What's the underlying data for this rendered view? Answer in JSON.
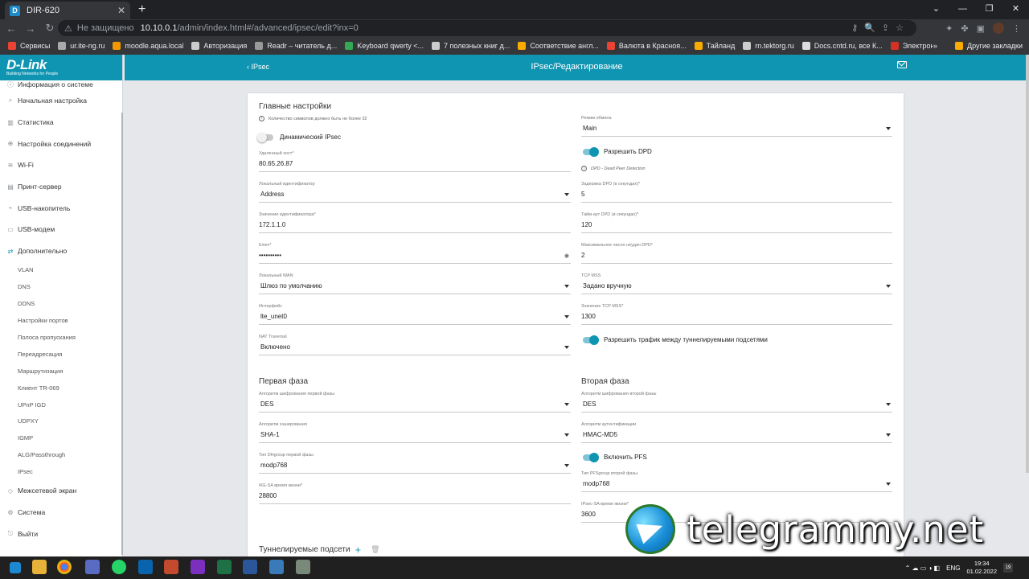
{
  "browser": {
    "tab_title": "DIR-620",
    "tab_favicon": "D",
    "new_tab": "+",
    "url_warning": "Не защищено",
    "url_host": "10.10.0.1",
    "url_path": "/admin/index.html#/advanced/ipsec/edit?inx=0",
    "bookmarks": [
      {
        "label": "Сервисы",
        "color": "#ea4335"
      },
      {
        "label": "ur.ite-ng.ru",
        "color": "#aaaaaa"
      },
      {
        "label": "moodle.aqua.local",
        "color": "#f29900"
      },
      {
        "label": "Авторизация",
        "color": "#cccccc"
      },
      {
        "label": "Readr – читатель д...",
        "color": "#999999"
      },
      {
        "label": "Keyboard qwerty <...",
        "color": "#34a853"
      },
      {
        "label": "7 полезных книг д...",
        "color": "#cccccc"
      },
      {
        "label": "Соответствие англ...",
        "color": "#f9ab00"
      },
      {
        "label": "Валюта в Красноя...",
        "color": "#ea4335"
      },
      {
        "label": "Тайланд",
        "color": "#f9ab00"
      },
      {
        "label": "rn.tektorg.ru",
        "color": "#cccccc"
      },
      {
        "label": "Docs.cntd.ru, все К...",
        "color": "#dddddd"
      },
      {
        "label": "Электронный жур...",
        "color": "#d93025"
      }
    ],
    "bookmarks_more": "»",
    "other_bookmarks": "Другие закладки"
  },
  "logo": {
    "brand": "D-Link",
    "tagline": "Building Networks for People"
  },
  "sidebar": {
    "items": [
      {
        "label": "Информация о системе",
        "icon": "info-icon"
      },
      {
        "label": "Начальная настройка",
        "icon": "search-icon"
      },
      {
        "label": "Статистика",
        "icon": "chart-icon"
      },
      {
        "label": "Настройка соединений",
        "icon": "globe-icon"
      },
      {
        "label": "Wi-Fi",
        "icon": "wifi-icon"
      },
      {
        "label": "Принт-сервер",
        "icon": "printer-icon"
      },
      {
        "label": "USB-накопитель",
        "icon": "usb-icon"
      },
      {
        "label": "USB-модем",
        "icon": "modem-icon"
      },
      {
        "label": "Дополнительно",
        "icon": "arrows-icon"
      }
    ],
    "subitems": [
      "VLAN",
      "DNS",
      "DDNS",
      "Настройки портов",
      "Полоса пропускания",
      "Переадресация",
      "Маршрутизация",
      "Клиент TR-069",
      "UPnP IGD",
      "UDPXY",
      "IGMP",
      "ALG/Passthrough",
      "IPsec"
    ],
    "bottom_items": [
      {
        "label": "Межсетевой экран",
        "icon": "shield-icon"
      },
      {
        "label": "Система",
        "icon": "gear-icon"
      },
      {
        "label": "Выйти",
        "icon": "logout-icon"
      }
    ]
  },
  "header": {
    "back_label": "IPsec",
    "title": "IPsec/Редактирование"
  },
  "main_settings": {
    "title": "Главные настройки",
    "hint": "Количество символов должно быть не более 32",
    "dynamic_ipsec": "Динамический IPsec",
    "remote_host_label": "Удаленный хост*",
    "remote_host": "80.65.26.87",
    "local_id_label": "Локальный идентификатор",
    "local_id": "Address",
    "id_value_label": "Значение идентификатора*",
    "id_value": "172.1.1.0",
    "key_label": "Ключ*",
    "key": "••••••••••",
    "local_wan_label": "Локальный WAN",
    "local_wan": "Шлюз по умолчанию",
    "interface_label": "Интерфейс",
    "interface": "lte_unet0",
    "nat_label": "NAT Traversal",
    "nat": "Включено",
    "exchange_mode_label": "Режим обмена",
    "exchange_mode": "Main",
    "dpd": "Разрешить DPD",
    "dpd_hint": "DPD - Dead Peer Detection",
    "dpd_delay_label": "Задержка DPD (в секундах)*",
    "dpd_delay": "5",
    "dpd_timeout_label": "Тайм-аут DPD (в секундах)*",
    "dpd_timeout": "120",
    "dpd_max_label": "Максимальное число неудач DPD*",
    "dpd_max": "2",
    "tcp_mss_label": "TCP MSS",
    "tcp_mss": "Задано вручную",
    "tcp_mss_value_label": "Значение TCP MSS*",
    "tcp_mss_value": "1300",
    "allow_traffic": "Разрешить трафик между туннелируемыми подсетями"
  },
  "phase1": {
    "title": "Первая фаза",
    "enc_label": "Алгоритм шифрования первой фазы",
    "enc": "DES",
    "hash_label": "Алгоритм хэширования",
    "hash": "SHA-1",
    "dh_label": "Тип DHgroup первой фазы",
    "dh": "modp768",
    "ike_label": "IKE-SA время жизни*",
    "ike": "28800"
  },
  "phase2": {
    "title": "Вторая фаза",
    "enc_label": "Алгоритм шифрования второй фазы",
    "enc": "DES",
    "auth_label": "Алгоритм аутентификации",
    "auth": "HMAC-MD5",
    "pfs": "Включить PFS",
    "pfs_group_label": "Тип PFSgroup второй фазы",
    "pfs_group": "modp768",
    "ipsec_label": "IPsec-SA время жизни*",
    "ipsec": "3600"
  },
  "tunnels": {
    "title": "Туннелируемые подсети",
    "add": "+",
    "delete": "🗑"
  },
  "watermark": "telegrammy.net",
  "taskbar": {
    "lang": "ENG",
    "time": "19:34",
    "date": "01.02.2022",
    "notifications": "19"
  }
}
